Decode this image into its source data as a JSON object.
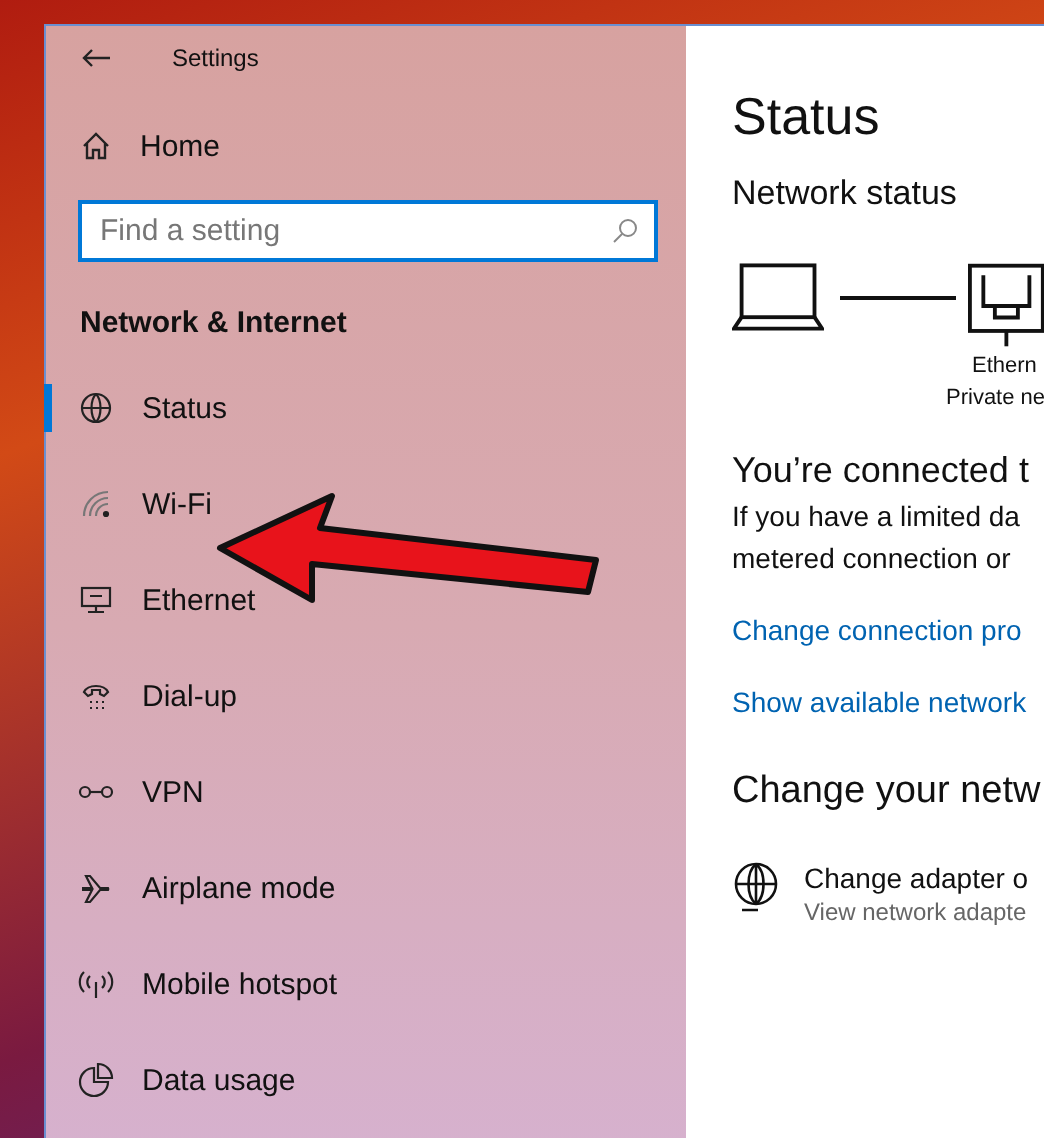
{
  "window": {
    "title": "Settings"
  },
  "sidebar": {
    "home": "Home",
    "search": {
      "placeholder": "Find a setting"
    },
    "section": "Network & Internet",
    "items": [
      {
        "label": "Status",
        "kind": "status",
        "selected": true
      },
      {
        "label": "Wi-Fi",
        "kind": "wifi",
        "selected": false
      },
      {
        "label": "Ethernet",
        "kind": "ethernet",
        "selected": false
      },
      {
        "label": "Dial-up",
        "kind": "dialup",
        "selected": false
      },
      {
        "label": "VPN",
        "kind": "vpn",
        "selected": false
      },
      {
        "label": "Airplane mode",
        "kind": "airplane",
        "selected": false
      },
      {
        "label": "Mobile hotspot",
        "kind": "hotspot",
        "selected": false
      },
      {
        "label": "Data usage",
        "kind": "data",
        "selected": false
      }
    ]
  },
  "content": {
    "title": "Status",
    "subtitle": "Network status",
    "diagram": {
      "label": "Ethern",
      "sublabel": "Private ne"
    },
    "connected": "You’re connected t",
    "paragraph": [
      "If you have a limited da",
      "metered connection or"
    ],
    "links": [
      "Change connection pro",
      "Show available network"
    ],
    "section": "Change your netw",
    "options": [
      {
        "title": "Change adapter o",
        "subtitle": "View network adapte"
      }
    ]
  }
}
